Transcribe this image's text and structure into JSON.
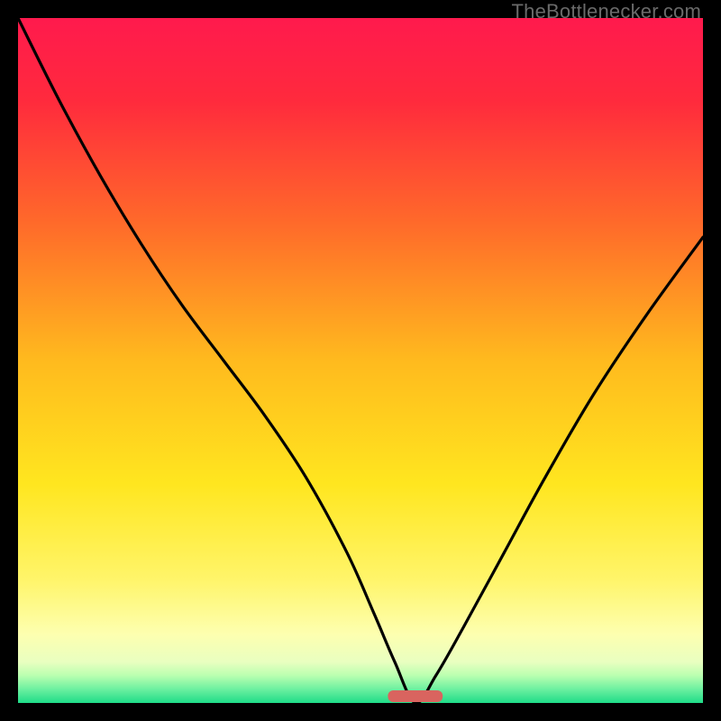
{
  "attribution": "TheBottlenecker.com",
  "chart_data": {
    "type": "line",
    "title": "",
    "xlabel": "",
    "ylabel": "",
    "xlim": [
      0,
      100
    ],
    "ylim": [
      0,
      100
    ],
    "optimal_x": 58,
    "series": [
      {
        "name": "bottleneck-curve",
        "x": [
          0,
          6,
          12,
          18,
          24,
          30,
          36,
          42,
          48,
          52,
          55,
          58,
          61,
          65,
          71,
          77,
          84,
          92,
          100
        ],
        "values": [
          100,
          88,
          77,
          67,
          58,
          50,
          42,
          33,
          22,
          13,
          6,
          0,
          4,
          11,
          22,
          33,
          45,
          57,
          68
        ]
      }
    ],
    "gradient_stops": [
      {
        "pct": 0,
        "color": "#ff1a4d"
      },
      {
        "pct": 12,
        "color": "#ff2a3d"
      },
      {
        "pct": 30,
        "color": "#ff6a2a"
      },
      {
        "pct": 50,
        "color": "#ffba1e"
      },
      {
        "pct": 68,
        "color": "#ffe61f"
      },
      {
        "pct": 82,
        "color": "#fff56a"
      },
      {
        "pct": 90,
        "color": "#fdffb0"
      },
      {
        "pct": 94,
        "color": "#e9ffc0"
      },
      {
        "pct": 96,
        "color": "#baffb0"
      },
      {
        "pct": 98,
        "color": "#6cf0a0"
      },
      {
        "pct": 100,
        "color": "#1fdc88"
      }
    ],
    "marker": {
      "x_start": 54,
      "x_end": 62,
      "color": "#d9645f"
    }
  }
}
